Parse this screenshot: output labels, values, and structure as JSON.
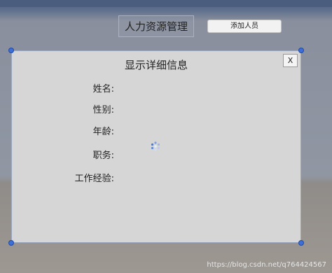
{
  "header": {
    "app_title": "人力资源管理",
    "add_button_label": "添加人员"
  },
  "dialog": {
    "title": "显示详细信息",
    "close_label": "X",
    "fields": {
      "name_label": "姓名:",
      "gender_label": "性别:",
      "age_label": "年龄:",
      "position_label": "职务:",
      "experience_label": "工作经验:"
    },
    "loading_icon": "loading-spinner-icon",
    "accent_color": "#3d6fd6"
  },
  "watermark": "https://blog.csdn.net/q764424567"
}
